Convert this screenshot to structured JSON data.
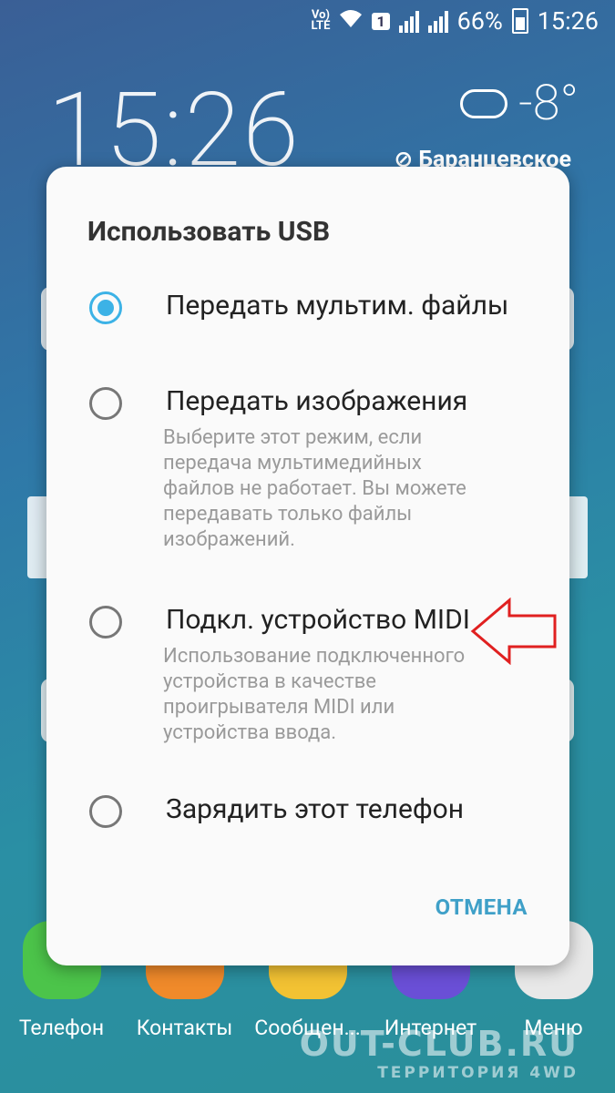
{
  "status_bar": {
    "volte": "Vo)\nLTE",
    "sim": "1",
    "battery": "66%",
    "time": "15:26"
  },
  "lockscreen": {
    "clock": "15:26",
    "temperature": "-8°",
    "location": "Баранцевское"
  },
  "dialog": {
    "title": "Использовать USB",
    "options": [
      {
        "label": "Передать мультим. файлы",
        "selected": true,
        "description": ""
      },
      {
        "label": "Передать изображения",
        "selected": false,
        "description": "Выберите этот режим, если передача мультимедийных файлов не работает. Вы можете передавать только файлы изображений."
      },
      {
        "label": "Подкл. устройство MIDI",
        "selected": false,
        "description": "Использование подключенного устройства в качестве проигрывателя MIDI или устройства ввода."
      },
      {
        "label": "Зарядить этот телефон",
        "selected": false,
        "description": ""
      }
    ],
    "cancel_label": "ОТМЕНА"
  },
  "dock": [
    {
      "label": "Телефон",
      "icon": "phone-icon",
      "color": "#4cc44a"
    },
    {
      "label": "Контакты",
      "icon": "contacts-icon",
      "color": "#f08a2a"
    },
    {
      "label": "Сообщен...",
      "icon": "messages-icon",
      "color": "#f2c233"
    },
    {
      "label": "Интернет",
      "icon": "internet-icon",
      "color": "#6a4fd6"
    },
    {
      "label": "Меню",
      "icon": "apps-icon",
      "color": "#e8e8e8"
    }
  ],
  "watermark": {
    "line1": "OUT-CLUB.RU",
    "line2": "ТЕРРИТОРИЯ 4WD"
  },
  "colors": {
    "accent": "#3cb2e6",
    "cancel": "#3fa0c8",
    "arrow": "#e02020"
  }
}
